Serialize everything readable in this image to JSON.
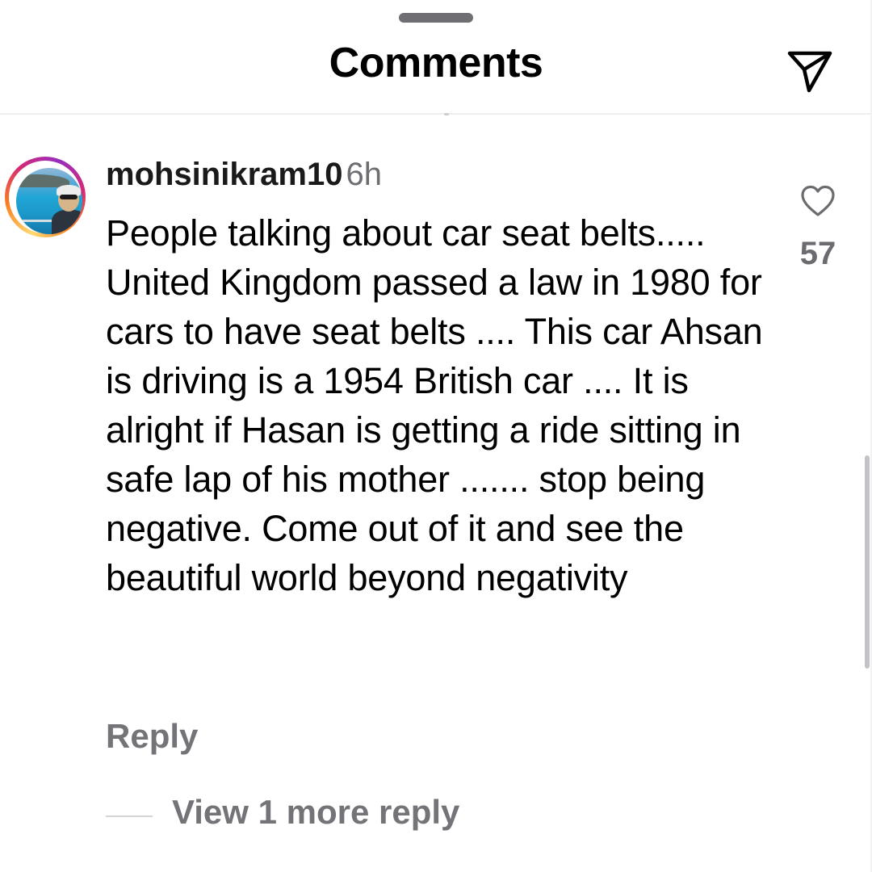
{
  "header": {
    "title": "Comments",
    "share_icon": "paper-plane-icon"
  },
  "comment": {
    "username": "mohsinikram10",
    "timestamp": "6h",
    "text": "People talking about car seat belts..... United Kingdom passed a law in 1980 for cars to have seat belts .... This car Ahsan is driving is a 1954 British car .... It is alright if Hasan is getting a ride sitting in safe lap of his mother ....... stop being negative. Come out of it and see the beautiful world beyond negativity",
    "like_icon": "heart-outline-icon",
    "like_count": "57",
    "reply_label": "Reply",
    "view_more_label": "View 1 more reply"
  },
  "colors": {
    "text_primary": "#000000",
    "text_secondary": "#737378",
    "story_ring": [
      "#feda75",
      "#fa7e1e",
      "#d62976",
      "#962fbf"
    ]
  }
}
